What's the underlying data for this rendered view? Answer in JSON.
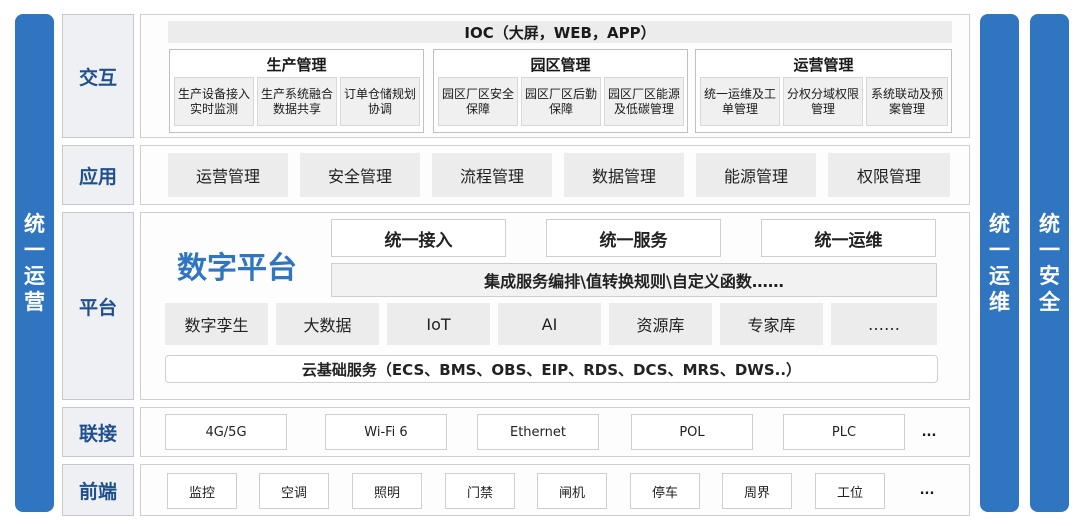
{
  "pillars": {
    "left": [
      "统",
      "一",
      "运",
      "营"
    ],
    "right1": [
      "统",
      "一",
      "运",
      "维"
    ],
    "right2": [
      "统",
      "一",
      "安",
      "全"
    ]
  },
  "layers": {
    "interaction": {
      "label": "交互",
      "ioc": "IOC（大屏，WEB，APP）",
      "groups": [
        {
          "title": "生产管理",
          "items": [
            "生产设备接入实时监测",
            "生产系统融合数据共享",
            "订单仓储规划协调"
          ]
        },
        {
          "title": "园区管理",
          "items": [
            "园区厂区安全保障",
            "园区厂区后勤保障",
            "园区厂区能源及低碳管理"
          ]
        },
        {
          "title": "运营管理",
          "items": [
            "统一运维及工单管理",
            "分权分域权限管理",
            "系统联动及预案管理"
          ]
        }
      ]
    },
    "application": {
      "label": "应用",
      "items": [
        "运营管理",
        "安全管理",
        "流程管理",
        "数据管理",
        "能源管理",
        "权限管理"
      ]
    },
    "platform": {
      "label": "平台",
      "title": "数字平台",
      "top": [
        "统一接入",
        "统一服务",
        "统一运维"
      ],
      "integration": "集成服务编排\\值转换规则\\自定义函数……",
      "modules": [
        "数字孪生",
        "大数据",
        "IoT",
        "AI",
        "资源库",
        "专家库",
        "……"
      ],
      "cloud": "云基础服务（ECS、BMS、OBS、EIP、RDS、DCS、MRS、DWS..）"
    },
    "connection": {
      "label": "联接",
      "items": [
        "4G/5G",
        "Wi-Fi 6",
        "Ethernet",
        "POL",
        "PLC"
      ],
      "more": "..."
    },
    "frontend": {
      "label": "前端",
      "items": [
        "监控",
        "空调",
        "照明",
        "门禁",
        "闸机",
        "停车",
        "周界",
        "工位"
      ],
      "more": "..."
    }
  }
}
